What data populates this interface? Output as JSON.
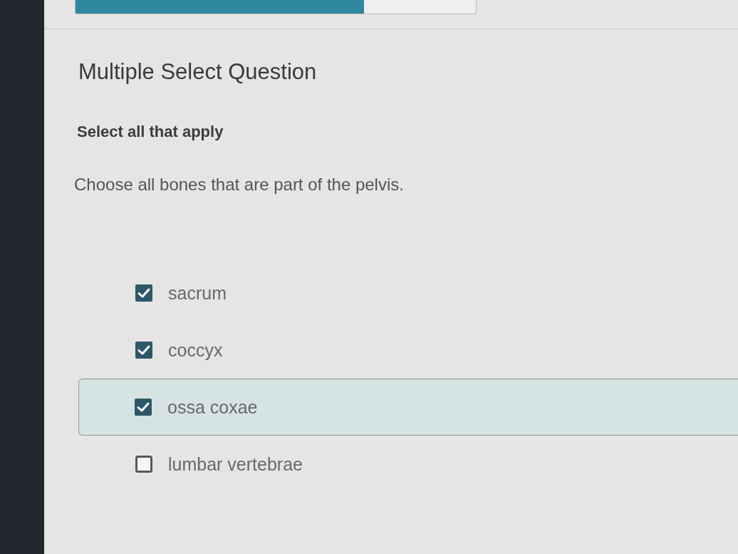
{
  "progress": {
    "level": 0.72
  },
  "question": {
    "type_label": "Multiple Select Question",
    "instruction": "Select all that apply",
    "prompt": "Choose all bones that are part of the pelvis.",
    "options": [
      {
        "label": "sacrum",
        "checked": true,
        "highlighted": false
      },
      {
        "label": "coccyx",
        "checked": true,
        "highlighted": false
      },
      {
        "label": "ossa coxae",
        "checked": true,
        "highlighted": true
      },
      {
        "label": "lumbar vertebrae",
        "checked": false,
        "highlighted": false
      }
    ]
  }
}
